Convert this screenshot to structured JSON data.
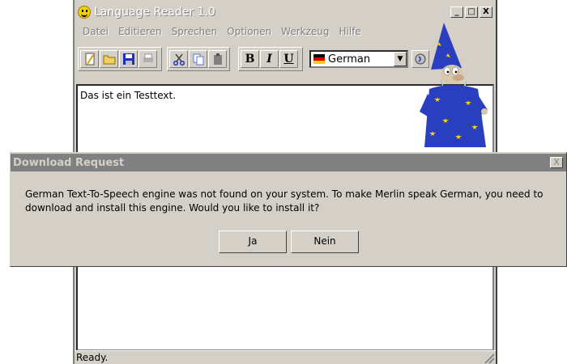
{
  "window": {
    "title": "Language Reader 1.0",
    "buttons": {
      "minimize": "_",
      "maximize": "□",
      "close": "X"
    }
  },
  "menu": [
    "Datei",
    "Editieren",
    "Sprechen",
    "Optionen",
    "Werkzeug",
    "Hilfe"
  ],
  "toolbar": {
    "bold": "B",
    "italic": "I",
    "underline": "U",
    "language": "German"
  },
  "editor": {
    "text": "Das ist ein Testtext."
  },
  "status": {
    "text": "Ready."
  },
  "dialog": {
    "title": "Download Request",
    "message": "German Text-To-Speech engine was not found on your system. To make Merlin speak German, you need to download and install this engine. Would you like to install it?",
    "yes_label": "Ja",
    "no_label": "Nein",
    "close": "X"
  },
  "colors": {
    "face": "#d4d0c8",
    "title_inactive": "#808080",
    "robe": "#2a3fbf",
    "stars": "#ffd400"
  }
}
